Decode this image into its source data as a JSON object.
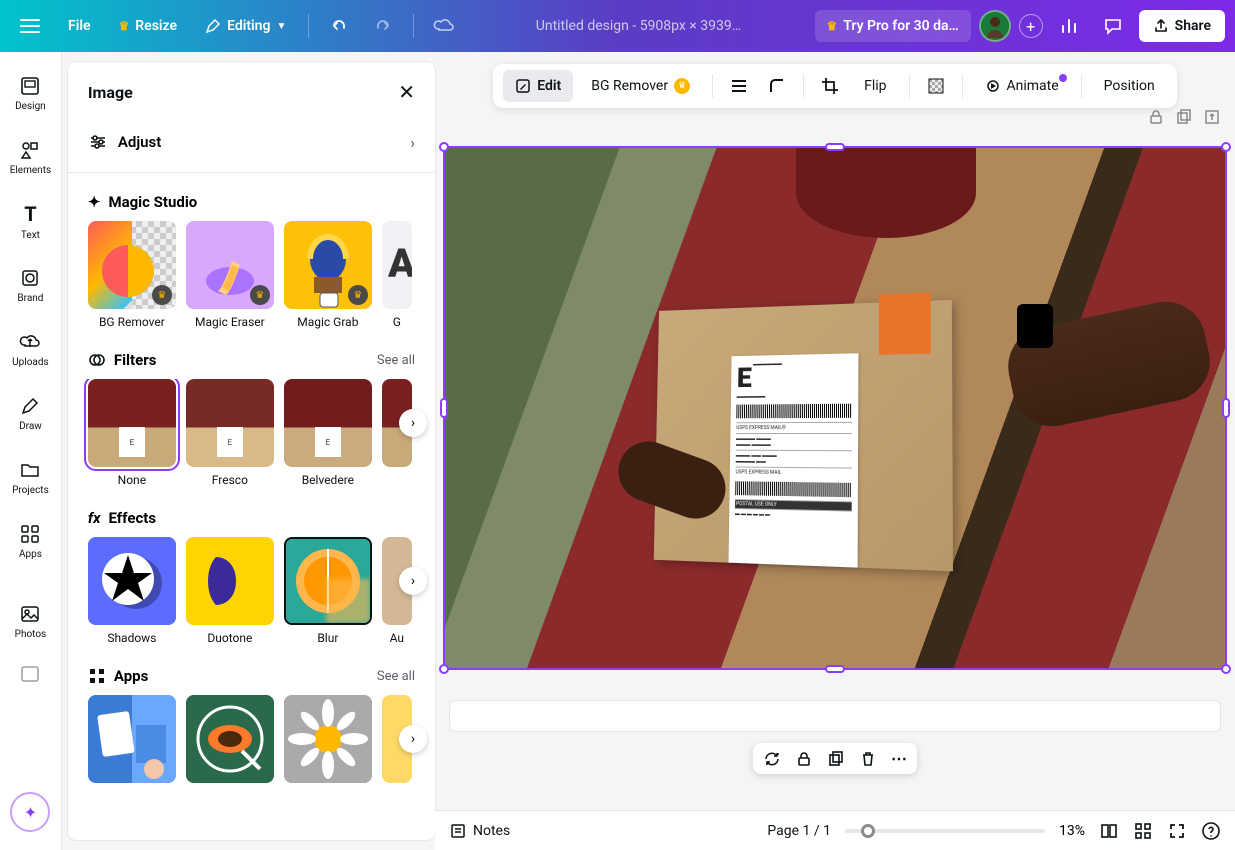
{
  "topbar": {
    "file": "File",
    "resize": "Resize",
    "editing": "Editing",
    "doc_title": "Untitled design - 5908px × 3939…",
    "try_pro": "Try Pro for 30 da…",
    "share": "Share"
  },
  "rail": {
    "design": "Design",
    "elements": "Elements",
    "text": "Text",
    "brand": "Brand",
    "uploads": "Uploads",
    "draw": "Draw",
    "projects": "Projects",
    "apps": "Apps",
    "photos": "Photos"
  },
  "panel": {
    "title": "Image",
    "adjust": "Adjust",
    "magic_studio": "Magic Studio",
    "magic_items": {
      "bg_remover": "BG Remover",
      "magic_eraser": "Magic Eraser",
      "magic_grab": "Magic Grab",
      "partial": "G"
    },
    "filters": "Filters",
    "see_all": "See all",
    "filter_items": {
      "none": "None",
      "fresco": "Fresco",
      "belvedere": "Belvedere"
    },
    "effects": "Effects",
    "effect_items": {
      "shadows": "Shadows",
      "duotone": "Duotone",
      "blur": "Blur",
      "partial": "Au"
    },
    "apps": "Apps"
  },
  "toolbar": {
    "edit": "Edit",
    "bg_remover": "BG Remover",
    "flip": "Flip",
    "animate": "Animate",
    "position": "Position"
  },
  "label_text": {
    "express": "USPS EXPRESS MAIL®",
    "express2": "USPS EXPRESS MAIL",
    "postal": "POSTAL USE ONLY"
  },
  "float": {},
  "bottom": {
    "notes": "Notes",
    "page": "Page 1 / 1",
    "zoom": "13%"
  }
}
